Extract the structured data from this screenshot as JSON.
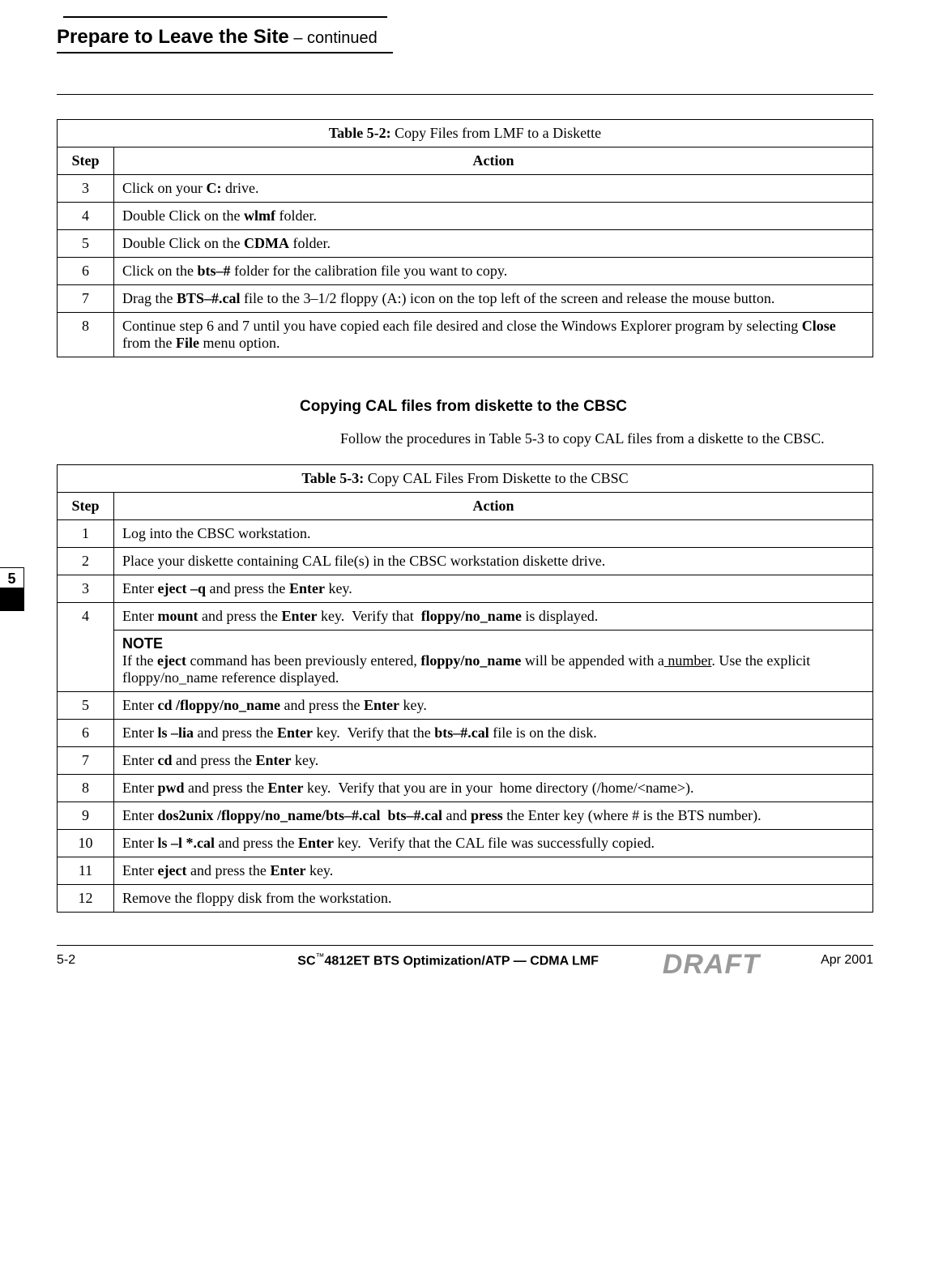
{
  "header": {
    "title": "Prepare to Leave the Site",
    "continued": " – continued"
  },
  "sideTab": "5",
  "table52": {
    "caption_bold": "Table 5-2:",
    "caption_rest": " Copy Files from LMF to a Diskette",
    "step_hdr": "Step",
    "action_hdr": "Action",
    "rows": [
      {
        "n": "3",
        "a": "Click on your <b>C:</b> drive."
      },
      {
        "n": "4",
        "a": "Double Click on the <b>wlmf</b> folder."
      },
      {
        "n": "5",
        "a": "Double Click on the <b>CDMA</b> folder."
      },
      {
        "n": "6",
        "a": "Click on the <b>bts–#</b> folder for the calibration file you want to copy."
      },
      {
        "n": "7",
        "a": "Drag the <b>BTS–#.cal</b> file to the 3–1/2 floppy (A:) icon on the top left of the screen and release the mouse button."
      },
      {
        "n": "8",
        "a": "Continue step 6 and 7 until you have copied each file desired and close the Windows Explorer program by selecting <b>Close</b> from the <b>File</b> menu option."
      }
    ]
  },
  "section": {
    "heading": "Copying CAL files from diskette to the CBSC",
    "body": "Follow the procedures in Table 5-3 to copy CAL files from a diskette to the CBSC."
  },
  "table53": {
    "caption_bold": "Table 5-3:",
    "caption_rest": " Copy CAL Files From Diskette to the CBSC",
    "step_hdr": "Step",
    "action_hdr": "Action",
    "rows": [
      {
        "n": "1",
        "a": "Log into the CBSC workstation."
      },
      {
        "n": "2",
        "a": "Place your diskette containing CAL file(s) in the CBSC workstation diskette drive."
      },
      {
        "n": "3",
        "a": "Enter <b>eject –q</b> and press the <b>Enter</b> key."
      },
      {
        "n": "4",
        "a": "Enter <b>mount</b> and press the <b>Enter</b> key.&nbsp;&nbsp;Verify that &nbsp;<b>floppy/no_name</b> is displayed."
      },
      {
        "n": "",
        "note": true,
        "a": "<span class='note-label'>NOTE</span><br>If the <b>eject</b> command has been previously entered, <b>floppy/no_name</b> will be appended with a<u> number</u>. Use the explicit floppy/no_name reference displayed."
      },
      {
        "n": "5",
        "a": "Enter <b>cd /floppy/no_name</b> and press the <b>Enter</b> key."
      },
      {
        "n": "6",
        "a": "Enter <b>ls –lia</b> and press the <b>Enter</b> key.&nbsp;&nbsp;Verify that the <b>bts–#.cal</b> file is on the disk."
      },
      {
        "n": "7",
        "a": "Enter <b>cd</b> and press the <b>Enter</b> key."
      },
      {
        "n": "8",
        "a": "Enter <b>pwd</b> and press the <b>Enter</b> key.&nbsp;&nbsp;Verify that you are in your &nbsp;home directory (/home/&lt;name&gt;)."
      },
      {
        "n": "9",
        "a": "Enter <b>dos2unix /floppy/no_name/bts–#.cal&nbsp;&nbsp;bts–#.cal</b> and <b>press</b> the Enter key (where # is the BTS number)."
      },
      {
        "n": "10",
        "a": "Enter <b>ls –l *.cal</b> and press the <b>Enter</b> key.&nbsp;&nbsp;Verify that the CAL file was successfully copied."
      },
      {
        "n": "11",
        "a": "Enter <b>eject</b> and press the <b>Enter</b> key."
      },
      {
        "n": "12",
        "a": "Remove the floppy disk from the workstation."
      }
    ]
  },
  "footer": {
    "page": "5-2",
    "center_pre": "SC",
    "center_tm": "™",
    "center_post": "4812ET BTS Optimization/ATP — CDMA LMF",
    "date": "Apr 2001",
    "draft": "DRAFT"
  }
}
